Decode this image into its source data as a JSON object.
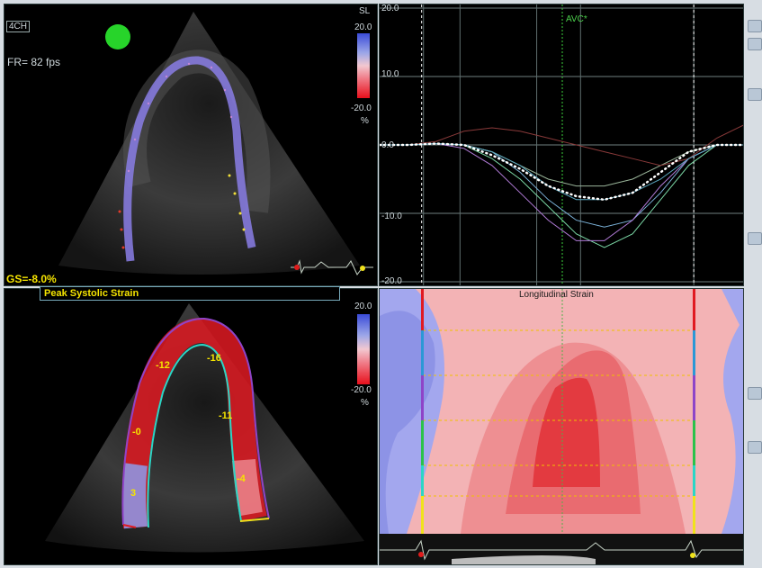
{
  "top_echo": {
    "view_label": "4CH",
    "frame_rate": "FR=  82 fps",
    "global_strain": "GS=-8.0%",
    "scale": {
      "title": "SL",
      "max": "20.0",
      "min": "-20.0",
      "unit": "%"
    }
  },
  "bottom_echo": {
    "title": "Peak Systolic Strain",
    "scale": {
      "max": "20.0",
      "min": "-20.0",
      "unit": "%"
    },
    "segment_values": [
      "-12",
      "-16",
      "-0",
      "-11",
      "3",
      "-4"
    ]
  },
  "strain_graph": {
    "y_ticks": [
      "20.0",
      "10.0",
      "0.0",
      "-10.0",
      "-20.0"
    ],
    "event_marker": "AVC*"
  },
  "mmode": {
    "title": "Longitudinal Strain"
  },
  "colors": {
    "positive_strain": "#3a4bd8",
    "negative_strain": "#e8101c",
    "overlay_text": "#f5e400",
    "event_marker": "#4cd04c"
  },
  "chart_data": {
    "type": "line",
    "ylim": [
      -20,
      20
    ],
    "series": [
      {
        "values": [
          0,
          0,
          0.2,
          0,
          -1,
          -4,
          -8,
          -11,
          -12,
          -11,
          -7,
          -2,
          0,
          0
        ]
      },
      {
        "values": [
          0,
          0,
          0.2,
          0,
          -2,
          -5,
          -9,
          -13,
          -15,
          -13,
          -8,
          -3,
          0,
          0
        ]
      },
      {
        "values": [
          0,
          0,
          0.2,
          -0.5,
          -3,
          -7,
          -11,
          -14,
          -14,
          -11,
          -6,
          -2,
          0,
          0
        ]
      },
      {
        "values": [
          0,
          0,
          0.2,
          0,
          -1,
          -3,
          -5,
          -6,
          -6,
          -5,
          -3,
          -1,
          0,
          0
        ]
      },
      {
        "values": [
          0,
          0,
          0.5,
          2,
          2.5,
          2,
          1,
          0,
          -1,
          -2,
          -3,
          -2,
          1,
          3
        ]
      },
      {
        "values": [
          0,
          0,
          0.2,
          0,
          -1,
          -3,
          -6,
          -8,
          -8,
          -7,
          -5,
          -2,
          0,
          0
        ]
      }
    ],
    "average": [
      0,
      0,
      0.2,
      0,
      -1.5,
      -3.5,
      -6,
      -7.5,
      -8,
      -7,
      -4,
      -1,
      0,
      0
    ]
  }
}
